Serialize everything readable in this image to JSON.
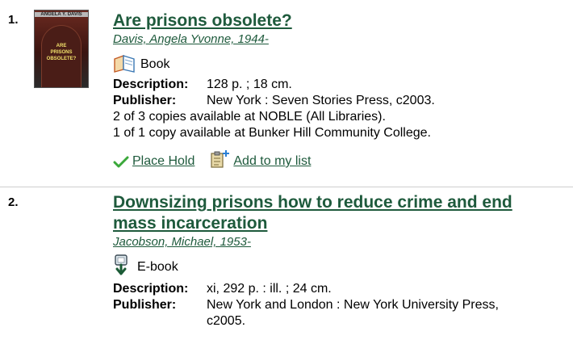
{
  "results": [
    {
      "number": "1.",
      "cover": {
        "author": "ANGELA Y. DAVIS",
        "title_line1": "ARE",
        "title_line2": "PRISONS",
        "title_line3": "OBSOLETE?"
      },
      "title": "Are prisons obsolete?",
      "author": "Davis, Angela Yvonne, 1944-",
      "format_icon": "book-icon",
      "format": "Book",
      "description_label": "Description:",
      "description": "128 p. ; 18 cm.",
      "publisher_label": "Publisher:",
      "publisher": "New York : Seven Stories Press, c2003.",
      "availability": [
        "2 of 3 copies available at NOBLE (All Libraries).",
        "1 of 1 copy available at Bunker Hill Community College."
      ],
      "actions": {
        "place_hold": "Place Hold",
        "add_to_list": " Add to my list"
      }
    },
    {
      "number": "2.",
      "title_line1": "Downsizing prisons how to reduce crime and end",
      "title_line2": "mass incarceration",
      "author": "Jacobson, Michael, 1953-",
      "format_icon": "ebook-download-icon",
      "format": "E-book",
      "description_label": "Description:",
      "description": "xi, 292 p. : ill. ; 24 cm.",
      "publisher_label": "Publisher:",
      "publisher": "New York and London : New York University Press, c2005."
    }
  ],
  "colors": {
    "link": "#1e5a3c",
    "check": "#3aa83a"
  }
}
